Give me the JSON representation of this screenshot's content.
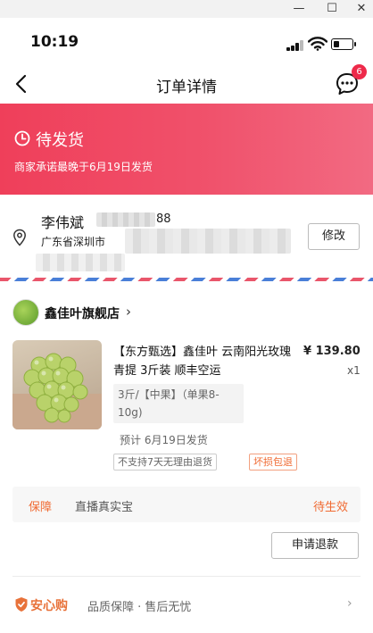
{
  "window": {
    "minimize": "—",
    "maximize": "☐",
    "close": "✕"
  },
  "status_bar": {
    "time": "10:19",
    "battery_level": 0.35
  },
  "nav": {
    "title": "订单详情",
    "chat_badge": "6"
  },
  "banner": {
    "state": "待发货",
    "promise": "商家承诺最晚于6月19日发货"
  },
  "address": {
    "name": "李伟斌",
    "phone_tail": "88",
    "location": "广东省深圳市",
    "edit_label": "修改"
  },
  "shop": {
    "name": "鑫佳叶旗舰店",
    "chevron": "›"
  },
  "product": {
    "title": "【东方甄选】鑫佳叶 云南阳光玫瑰青提 3斤装 顺丰空运",
    "price": "¥ 139.80",
    "quantity": "x1",
    "spec": "3斤/【中果】（单果8-10g)",
    "ship_estimate": "预计 6月19日发货",
    "tags": [
      "不支持7天无理由退货",
      "坏损包退"
    ]
  },
  "guarantee": {
    "label": "保障",
    "text": "直播真实宝",
    "status": "待生效"
  },
  "refund_label": "申请退款",
  "safe_buy": {
    "brand": "安心购",
    "desc": "品质保障 · 售后无忧",
    "chevron": "›"
  },
  "colors": {
    "accent": "#ee2a4a",
    "warning": "#f06a32"
  }
}
